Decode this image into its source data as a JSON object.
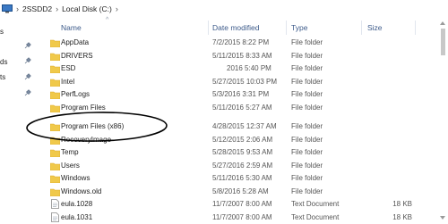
{
  "breadcrumb": {
    "computer": "2SSDD2",
    "drive": "Local Disk (C:)"
  },
  "columns": {
    "name": "Name",
    "date": "Date modified",
    "type": "Type",
    "size": "Size"
  },
  "left_pane": {
    "labels": [
      "s",
      "ds",
      "ts"
    ]
  },
  "files": [
    {
      "name": "AppData",
      "date": "7/2/2015 8:22 PM",
      "type": "File folder",
      "size": "",
      "kind": "folder"
    },
    {
      "name": "DRIVERS",
      "date": "5/11/2015 8:33 AM",
      "type": "File folder",
      "size": "",
      "kind": "folder"
    },
    {
      "name": "ESD",
      "date": "2016 5:40 PM",
      "type": "File folder",
      "size": "",
      "kind": "folder"
    },
    {
      "name": "Intel",
      "date": "5/27/2015 10:03 PM",
      "type": "File folder",
      "size": "",
      "kind": "folder"
    },
    {
      "name": "PerfLogs",
      "date": "5/3/2016 3:31 PM",
      "type": "File folder",
      "size": "",
      "kind": "folder"
    },
    {
      "name": "Program Files",
      "date": "5/11/2016 5:27 AM",
      "type": "File folder",
      "size": "",
      "kind": "folder"
    },
    {
      "name": "Program Files (x86)",
      "date": "4/28/2015 12:37 AM",
      "type": "File folder",
      "size": "",
      "kind": "folder"
    },
    {
      "name": "RecoveryImage",
      "date": "5/12/2015 2:06 AM",
      "type": "File folder",
      "size": "",
      "kind": "folder"
    },
    {
      "name": "Temp",
      "date": "5/28/2015 9:53 AM",
      "type": "File folder",
      "size": "",
      "kind": "folder"
    },
    {
      "name": "Users",
      "date": "5/27/2016 2:59 AM",
      "type": "File folder",
      "size": "",
      "kind": "folder"
    },
    {
      "name": "Windows",
      "date": "5/11/2016 5:30 AM",
      "type": "File folder",
      "size": "",
      "kind": "folder"
    },
    {
      "name": "Windows.old",
      "date": "5/8/2016 5:28 AM",
      "type": "File folder",
      "size": "",
      "kind": "folder"
    },
    {
      "name": "eula.1028",
      "date": "11/7/2007 8:00 AM",
      "type": "Text Document",
      "size": "18 KB",
      "kind": "doc"
    },
    {
      "name": "eula.1031",
      "date": "11/7/2007 8:00 AM",
      "type": "Text Document",
      "size": "18 KB",
      "kind": "doc"
    }
  ],
  "colors": {
    "folder": "#f0c94a",
    "folder_dark": "#dcaa2c",
    "header_text": "#3c5a8a",
    "annotation_ellipse": "#000000"
  },
  "icons": {
    "computer": "computer-icon",
    "pin": "pin-icon",
    "folder": "folder-icon",
    "document": "text-document-icon",
    "sort": "chevron-up-icon"
  }
}
